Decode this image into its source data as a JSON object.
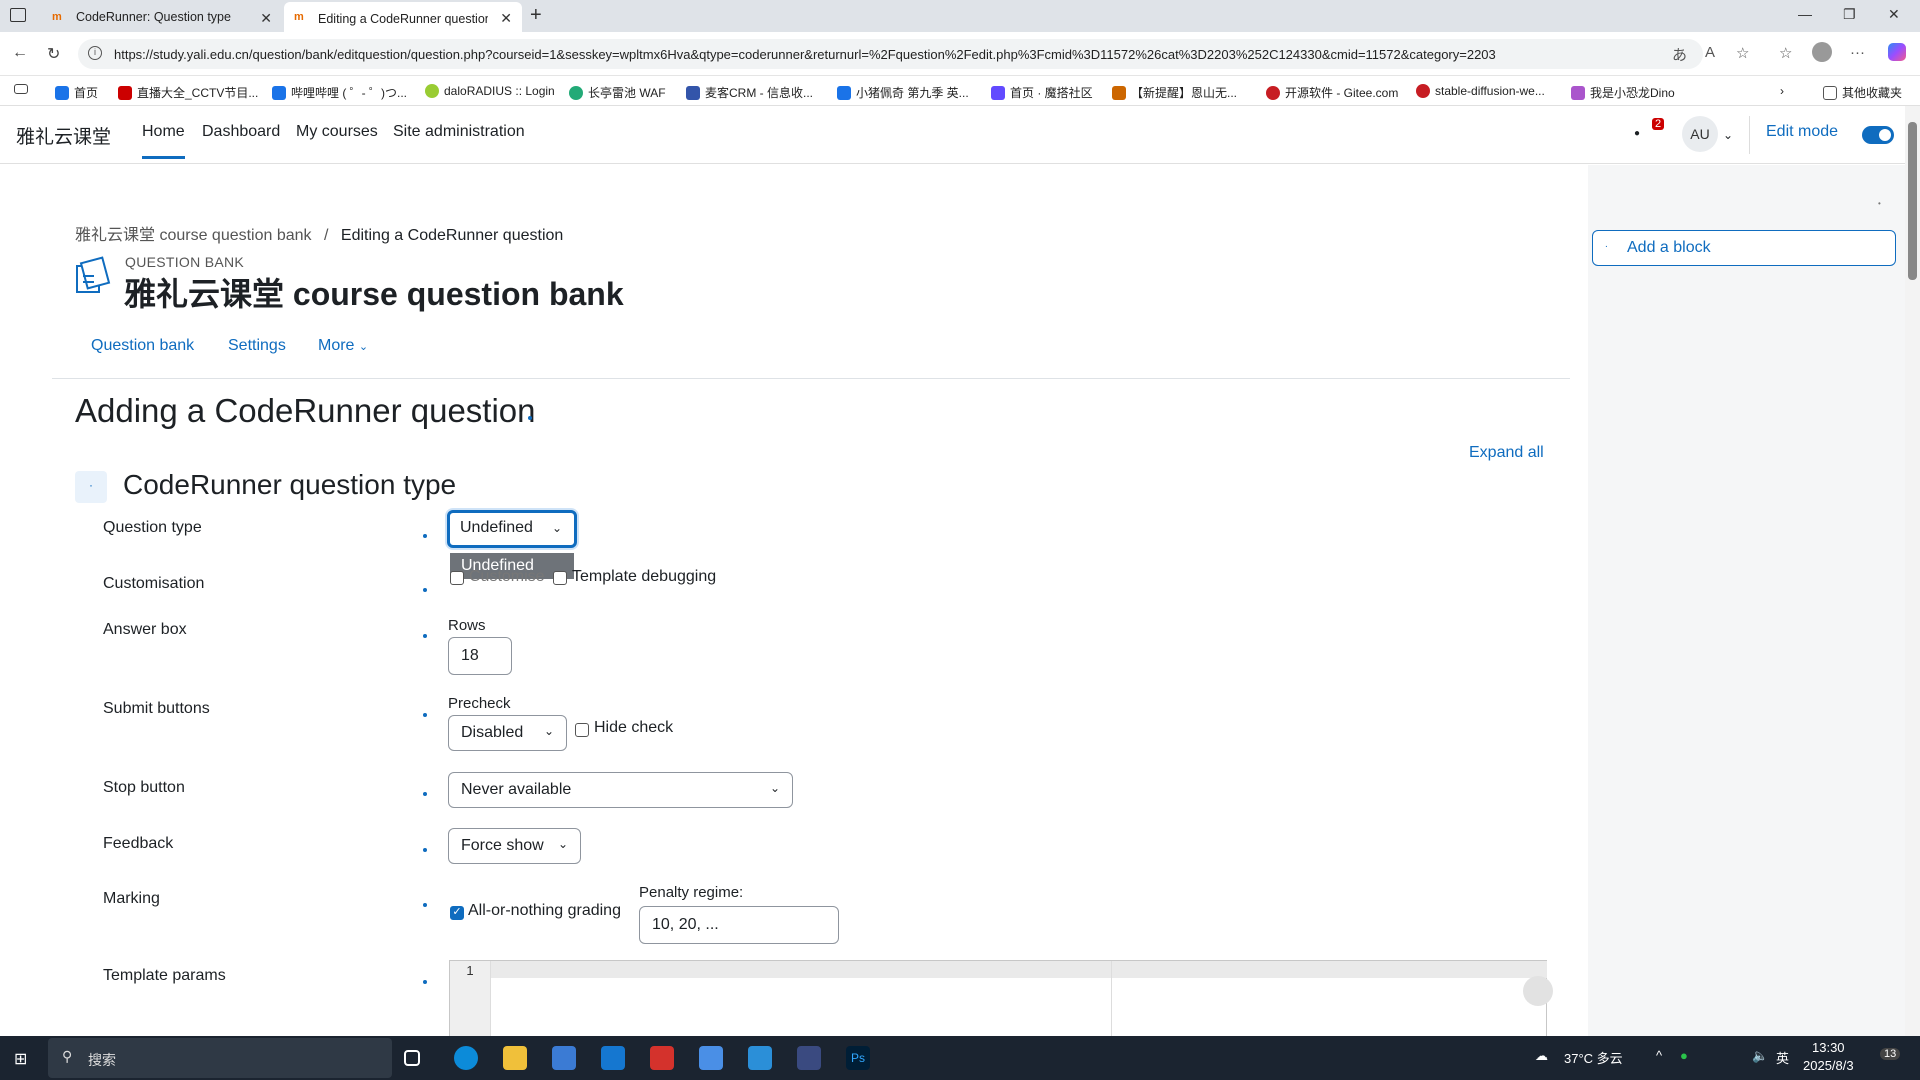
{
  "browser": {
    "tabs": [
      {
        "title": "CodeRunner: Question type"
      },
      {
        "title": "Editing a CodeRunner question | 雅"
      }
    ],
    "url": "https://study.yali.edu.cn/question/bank/editquestion/question.php?courseid=1&sesskey=wpltmx6Hva&qtype=coderunner&returnurl=%2Fquestion%2Fedit.php%3Fcmid%3D11572%26cat%3D2203%252C124330&cmid=11572&category=2203",
    "bookmarks": [
      "首页",
      "直播大全_CCTV节目...",
      "哔哩哔哩 ( ゜- ゜)つ...",
      "daloRADIUS :: Login",
      "长亭雷池 WAF",
      "麦客CRM - 信息收...",
      "小猪佩奇 第九季 英...",
      "首页 · 魔搭社区",
      "【新提醒】恩山无...",
      "开源软件 - Gitee.com",
      "stable-diffusion-we...",
      "我是小恐龙Dino"
    ],
    "other_bookmarks": "其他收藏夹"
  },
  "nav": {
    "brand": "雅礼云课堂",
    "links": [
      "Home",
      "Dashboard",
      "My courses",
      "Site administration"
    ],
    "avatar": "AU",
    "notif_count": "2",
    "edit_mode": "Edit mode"
  },
  "drawer": {
    "add_block": "Add a block"
  },
  "breadcrumb": {
    "first": "雅礼云课堂 course question bank",
    "sep": "/",
    "current": "Editing a CodeRunner question"
  },
  "header": {
    "small": "QUESTION BANK",
    "title": "雅礼云课堂 course question bank"
  },
  "subnav": [
    "Question bank",
    "Settings",
    "More"
  ],
  "main": {
    "heading": "Adding a CodeRunner question",
    "expand_all": "Expand all",
    "section": "CodeRunner question type"
  },
  "form": {
    "question_type": {
      "label": "Question type",
      "value": "Undefined",
      "dropdown_option": "Undefined"
    },
    "customisation": {
      "label": "Customisation",
      "customise": "Customise",
      "template_debugging": "Template debugging"
    },
    "answer_box": {
      "label": "Answer box",
      "rows_label": "Rows",
      "rows": "18"
    },
    "submit_buttons": {
      "label": "Submit buttons",
      "precheck_label": "Precheck",
      "precheck": "Disabled",
      "hide_check": "Hide check"
    },
    "stop_button": {
      "label": "Stop button",
      "value": "Never available"
    },
    "feedback": {
      "label": "Feedback",
      "value": "Force show"
    },
    "marking": {
      "label": "Marking",
      "all_or_nothing": "All-or-nothing grading",
      "all_or_nothing_checked": true,
      "penalty_label": "Penalty regime:",
      "penalty": "10, 20, ..."
    },
    "template_params": {
      "label": "Template params",
      "line": "1"
    }
  },
  "taskbar": {
    "search": "搜索",
    "weather": "37°C 多云",
    "ime": "英",
    "time": "13:30",
    "date": "2025/8/3",
    "notif": "13"
  },
  "colors": {
    "accent": "#0f6cbf",
    "text": "#1d2125",
    "taskbar": "#1b2430"
  }
}
